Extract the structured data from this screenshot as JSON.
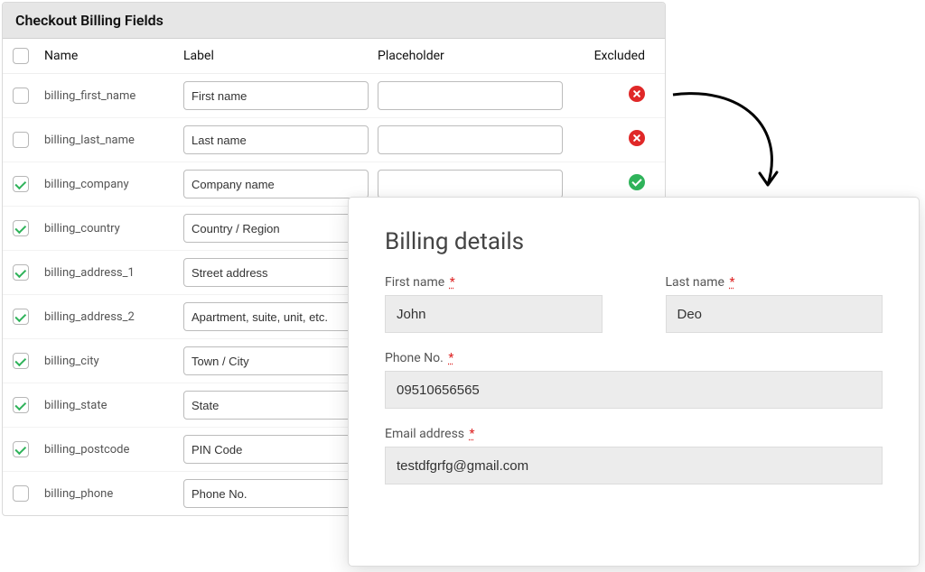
{
  "panel": {
    "title": "Checkout Billing Fields",
    "headers": {
      "name": "Name",
      "label": "Label",
      "placeholder": "Placeholder",
      "excluded": "Excluded"
    },
    "rows": [
      {
        "checked": false,
        "name": "billing_first_name",
        "label": "First name",
        "placeholder": "",
        "excluded": "no"
      },
      {
        "checked": false,
        "name": "billing_last_name",
        "label": "Last name",
        "placeholder": "",
        "excluded": "no"
      },
      {
        "checked": true,
        "name": "billing_company",
        "label": "Company name",
        "placeholder": "",
        "excluded": "yes"
      },
      {
        "checked": true,
        "name": "billing_country",
        "label": "Country / Region",
        "placeholder": "",
        "excluded": ""
      },
      {
        "checked": true,
        "name": "billing_address_1",
        "label": "Street address",
        "placeholder": "",
        "excluded": ""
      },
      {
        "checked": true,
        "name": "billing_address_2",
        "label": "Apartment, suite, unit, etc.",
        "placeholder": "",
        "excluded": ""
      },
      {
        "checked": true,
        "name": "billing_city",
        "label": "Town / City",
        "placeholder": "",
        "excluded": ""
      },
      {
        "checked": true,
        "name": "billing_state",
        "label": "State",
        "placeholder": "",
        "excluded": ""
      },
      {
        "checked": true,
        "name": "billing_postcode",
        "label": "PIN Code",
        "placeholder": "",
        "excluded": ""
      },
      {
        "checked": false,
        "name": "billing_phone",
        "label": "Phone No.",
        "placeholder": "",
        "excluded": ""
      }
    ]
  },
  "card": {
    "title": "Billing details",
    "fields": {
      "first_name": {
        "label": "First name",
        "value": "John",
        "required": true
      },
      "last_name": {
        "label": "Last name",
        "value": "Deo",
        "required": true
      },
      "phone": {
        "label": "Phone No.",
        "value": "09510656565",
        "required": true
      },
      "email": {
        "label": "Email address",
        "value": "testdfgrfg@gmail.com",
        "required": true
      }
    },
    "required_marker": "*"
  },
  "colors": {
    "error": "#e02828",
    "success": "#2fb35a"
  }
}
